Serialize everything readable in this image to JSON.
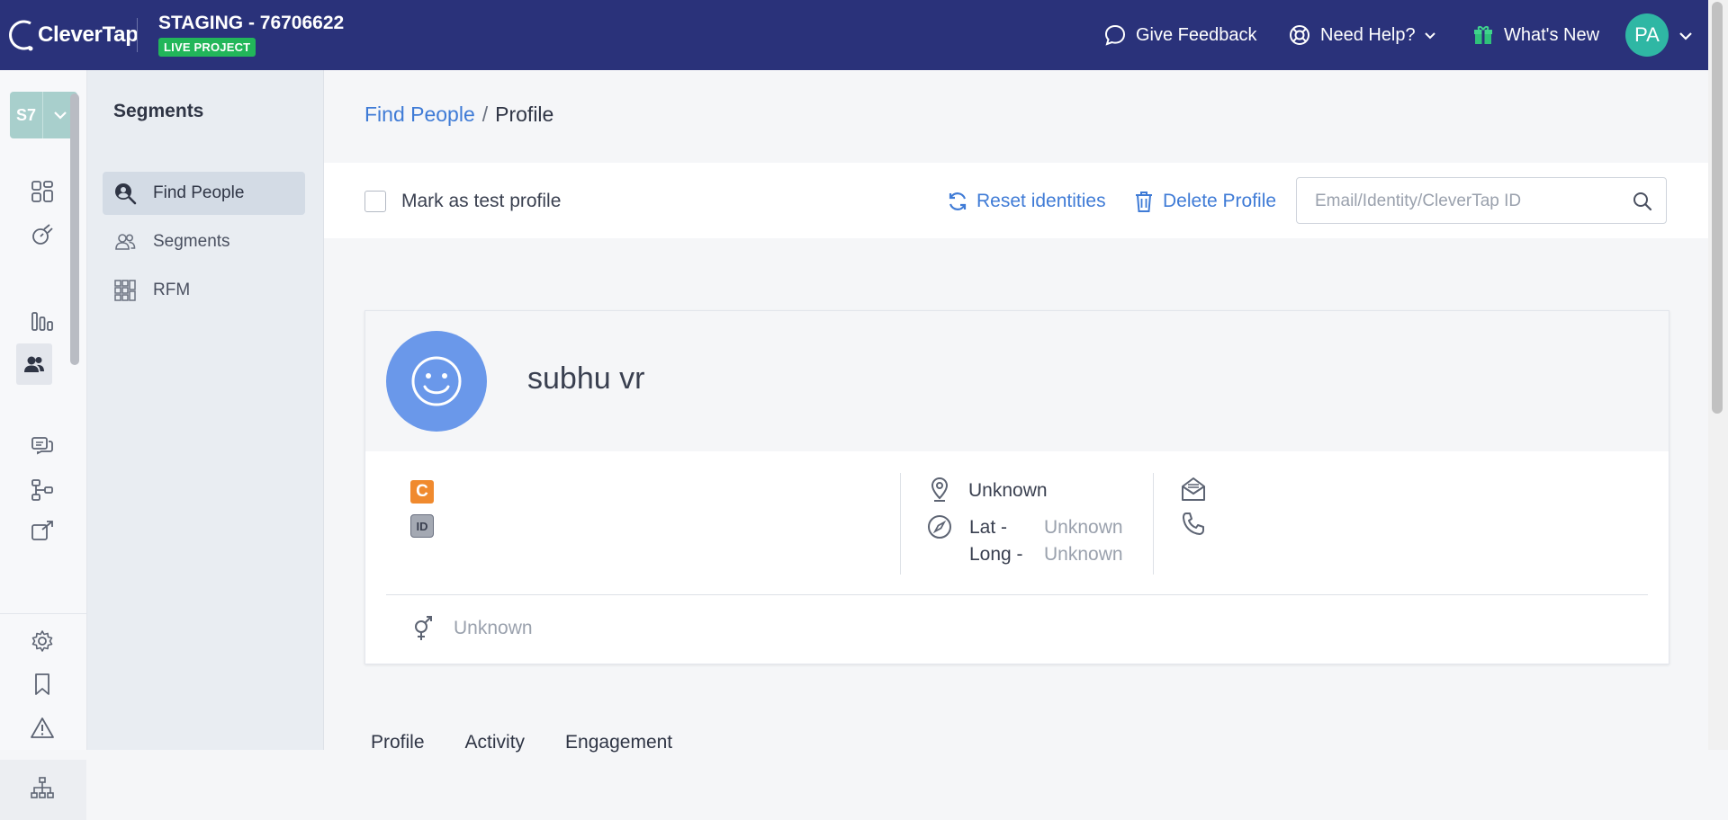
{
  "topbar": {
    "logo_text": "CleverTap",
    "project_name": "STAGING - 76706622",
    "project_badge": "LIVE PROJECT",
    "give_feedback": "Give Feedback",
    "need_help": "Need Help?",
    "whats_new": "What's New",
    "user_initials": "PA"
  },
  "rail": {
    "workspace_code": "S7"
  },
  "sidebar": {
    "title": "Segments",
    "items": [
      {
        "label": "Find People",
        "icon": "find-people-icon"
      },
      {
        "label": "Segments",
        "icon": "segments-icon"
      },
      {
        "label": "RFM",
        "icon": "rfm-grid-icon"
      }
    ]
  },
  "breadcrumb": {
    "parent": "Find People",
    "separator": "/",
    "current": "Profile"
  },
  "toolbar": {
    "mark_test_label": "Mark as test profile",
    "reset_identities": "Reset identities",
    "delete_profile": "Delete Profile",
    "search_placeholder": "Email/Identity/CleverTap ID"
  },
  "profile": {
    "name": "subhu vr",
    "badge_c": "C",
    "badge_id": "ID",
    "location": "Unknown",
    "lat_label": "Lat -",
    "lat_value": "Unknown",
    "long_label": "Long -",
    "long_value": "Unknown",
    "gender": "Unknown"
  },
  "tabs": [
    "Profile",
    "Activity",
    "Engagement"
  ],
  "colors": {
    "topbar_bg": "#2a327a",
    "accent_link": "#3f7bd6",
    "live_badge": "#22b65a",
    "avatar_bg": "#2fb7a4",
    "profile_avatar_bg": "#6a98ea",
    "badge_c_bg": "#f08a2e"
  }
}
